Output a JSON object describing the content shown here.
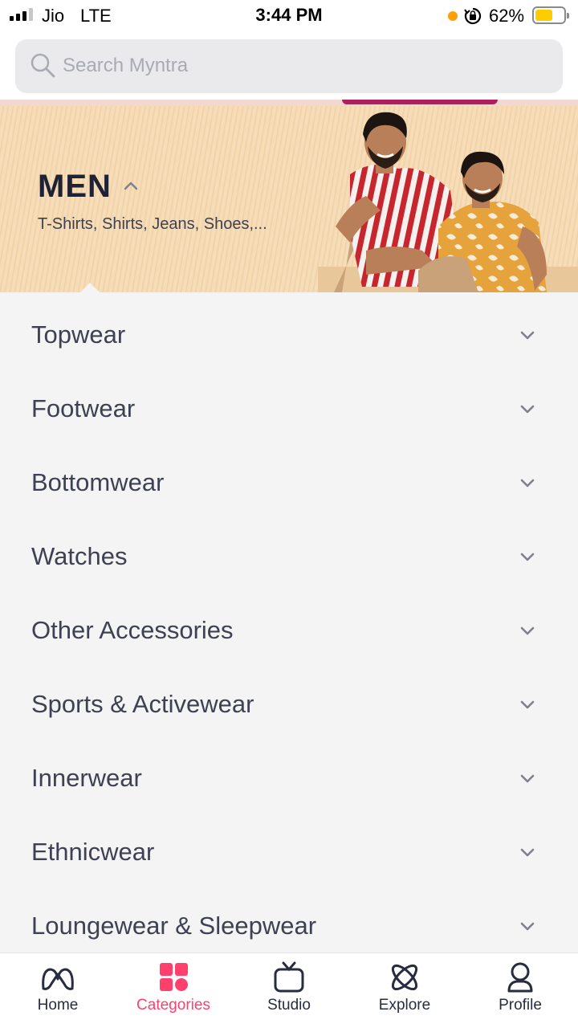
{
  "status_bar": {
    "carrier": "Jio",
    "network": "LTE",
    "time": "3:44 PM",
    "battery_percent": "62%",
    "battery_level": 0.62
  },
  "search": {
    "placeholder": "Search Myntra"
  },
  "banner": {
    "title": "MEN",
    "subtitle": "T-Shirts, Shirts, Jeans, Shoes,..."
  },
  "categories": [
    {
      "label": "Topwear"
    },
    {
      "label": "Footwear"
    },
    {
      "label": "Bottomwear"
    },
    {
      "label": "Watches"
    },
    {
      "label": "Other Accessories"
    },
    {
      "label": "Sports & Activewear"
    },
    {
      "label": "Innerwear"
    },
    {
      "label": "Ethnicwear"
    },
    {
      "label": "Loungewear & Sleepwear"
    }
  ],
  "bottom_nav": [
    {
      "label": "Home",
      "icon": "myntra-logo-icon",
      "active": false
    },
    {
      "label": "Categories",
      "icon": "grid-icon",
      "active": true
    },
    {
      "label": "Studio",
      "icon": "tv-icon",
      "active": false
    },
    {
      "label": "Explore",
      "icon": "atom-icon",
      "active": false
    },
    {
      "label": "Profile",
      "icon": "user-icon",
      "active": false
    }
  ],
  "colors": {
    "accent": "#ff3f6c",
    "text": "#282c3f",
    "list_bg": "#f4f4f5"
  }
}
